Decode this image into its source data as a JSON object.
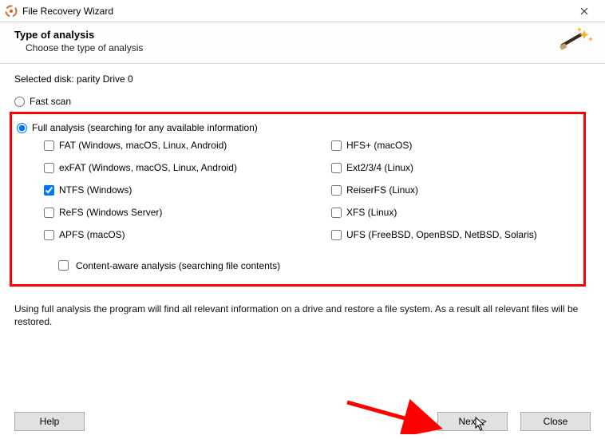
{
  "window": {
    "title": "File Recovery Wizard"
  },
  "header": {
    "heading": "Type of analysis",
    "subtitle": "Choose the type of analysis"
  },
  "selected_disk_label": "Selected disk: parity Drive 0",
  "scan": {
    "fast_label": "Fast scan",
    "full_label": "Full analysis (searching for any available information)"
  },
  "fs": {
    "left": [
      {
        "label": "FAT (Windows, macOS, Linux, Android)",
        "checked": false
      },
      {
        "label": "exFAT (Windows, macOS, Linux, Android)",
        "checked": false
      },
      {
        "label": "NTFS (Windows)",
        "checked": true
      },
      {
        "label": "ReFS (Windows Server)",
        "checked": false
      },
      {
        "label": "APFS (macOS)",
        "checked": false
      }
    ],
    "right": [
      {
        "label": "HFS+ (macOS)",
        "checked": false
      },
      {
        "label": "Ext2/3/4 (Linux)",
        "checked": false
      },
      {
        "label": "ReiserFS (Linux)",
        "checked": false
      },
      {
        "label": "XFS (Linux)",
        "checked": false
      },
      {
        "label": "UFS (FreeBSD, OpenBSD, NetBSD, Solaris)",
        "checked": false
      }
    ]
  },
  "content_aware_label": "Content-aware analysis (searching file contents)",
  "description_text": "Using full analysis the program will find all relevant information on a drive and restore a file system. As a result all relevant files will be restored.",
  "buttons": {
    "help": "Help",
    "next": "Next >",
    "close": "Close"
  }
}
